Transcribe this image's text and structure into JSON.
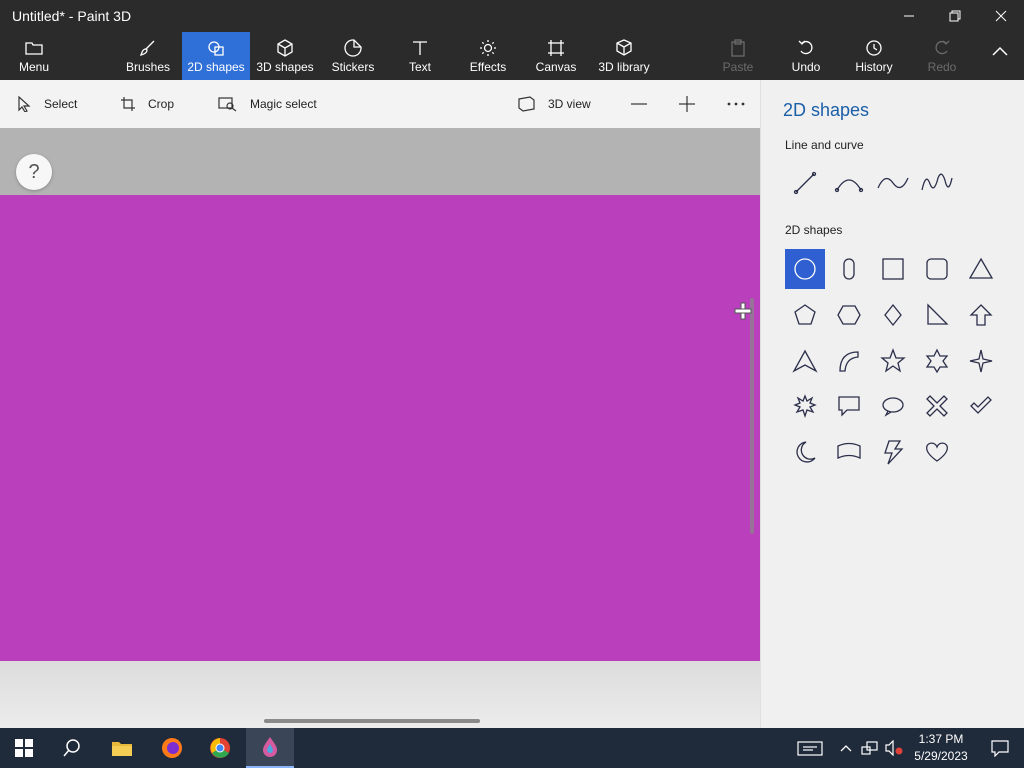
{
  "window": {
    "title": "Untitled* - Paint 3D"
  },
  "ribbon": {
    "menu": {
      "label": "Menu",
      "icon": "folder-icon"
    },
    "brushes": {
      "label": "Brushes",
      "icon": "brush-icon"
    },
    "shapes2d": {
      "label": "2D shapes",
      "icon": "shapes-2d-icon",
      "active": true
    },
    "shapes3d": {
      "label": "3D shapes",
      "icon": "cube-icon"
    },
    "stickers": {
      "label": "Stickers",
      "icon": "sticker-icon"
    },
    "text": {
      "label": "Text",
      "icon": "text-icon"
    },
    "effects": {
      "label": "Effects",
      "icon": "sun-icon"
    },
    "canvas": {
      "label": "Canvas",
      "icon": "canvas-icon"
    },
    "library3d": {
      "label": "3D library",
      "icon": "library-icon"
    },
    "paste": {
      "label": "Paste",
      "icon": "paste-icon",
      "disabled": true
    },
    "undo": {
      "label": "Undo",
      "icon": "undo-icon"
    },
    "history": {
      "label": "History",
      "icon": "history-icon"
    },
    "redo": {
      "label": "Redo",
      "icon": "redo-icon",
      "disabled": true
    }
  },
  "subtoolbar": {
    "select": "Select",
    "crop": "Crop",
    "magic_select": "Magic select",
    "view3d": "3D view"
  },
  "canvas": {
    "help_label": "?",
    "fill_color": "#b93fbd"
  },
  "panel": {
    "title": "2D shapes",
    "section_line": "Line and curve",
    "section_shapes": "2D shapes",
    "line_tools": [
      "line-icon",
      "curve-icon",
      "s-curve-icon",
      "wave-curve-icon"
    ],
    "shapes": [
      "circle-icon",
      "pill-icon",
      "square-icon",
      "rounded-square-icon",
      "triangle-icon",
      "pentagon-icon",
      "hexagon-icon",
      "diamond-icon",
      "right-triangle-icon",
      "arrow-up-icon",
      "chevron-arrow-icon",
      "quarter-arc-icon",
      "star-five-icon",
      "star-six-icon",
      "star-four-icon",
      "burst-icon",
      "speech-bubble-icon",
      "thought-bubble-icon",
      "x-mark-icon",
      "checkmark-icon",
      "moon-icon",
      "banner-icon",
      "lightning-icon",
      "heart-icon"
    ],
    "selected_shape": "circle-icon",
    "accent": "#2f5fd0"
  },
  "taskbar": {
    "time": "1:37 PM",
    "date": "5/29/2023"
  }
}
